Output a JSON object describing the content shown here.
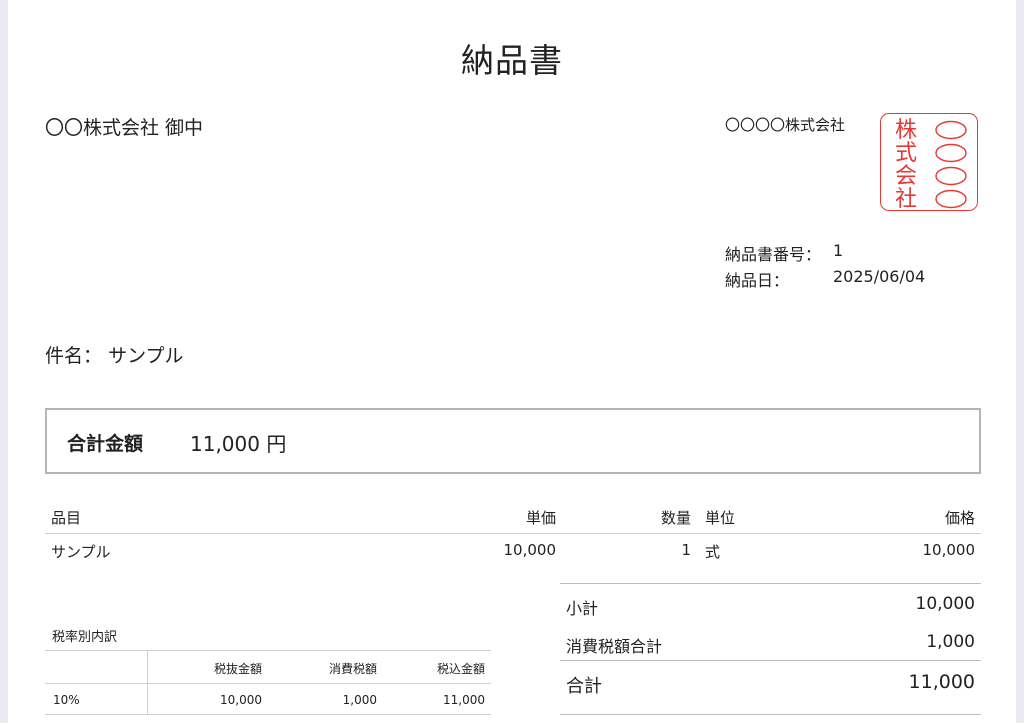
{
  "document": {
    "title": "納品書",
    "client": "〇〇株式会社 御中",
    "issuer": "〇〇〇〇株式会社",
    "seal": {
      "lines": [
        [
          "株",
          "〇"
        ],
        [
          "式",
          "〇"
        ],
        [
          "会",
          "〇"
        ],
        [
          "社",
          "〇"
        ]
      ],
      "color": "#e53935"
    },
    "number_label": "納品書番号：",
    "number_value": "1",
    "date_label": "納品日：",
    "date_value": "2025/06/04",
    "subject_label": "件名：",
    "subject_value": "サンプル",
    "total_label": "合計金額",
    "total_value": "11,000 円"
  },
  "items": {
    "headers": {
      "name": "品目",
      "unit_price": "単価",
      "qty": "数量",
      "unit": "単位",
      "price": "価格"
    },
    "rows": [
      {
        "name": "サンプル",
        "unit_price": "10,000",
        "qty": "1",
        "unit": "式",
        "price": "10,000"
      }
    ]
  },
  "summary": {
    "subtotal_label": "小計",
    "subtotal_value": "10,000",
    "tax_label": "消費税額合計",
    "tax_value": "1,000",
    "total_label": "合計",
    "total_value": "11,000"
  },
  "tax_breakdown": {
    "caption": "税率別内訳",
    "headers": {
      "rate": "",
      "excl": "税抜金額",
      "tax": "消費税額",
      "incl": "税込金額"
    },
    "rows": [
      {
        "rate": "10%",
        "excl": "10,000",
        "tax": "1,000",
        "incl": "11,000"
      }
    ]
  }
}
